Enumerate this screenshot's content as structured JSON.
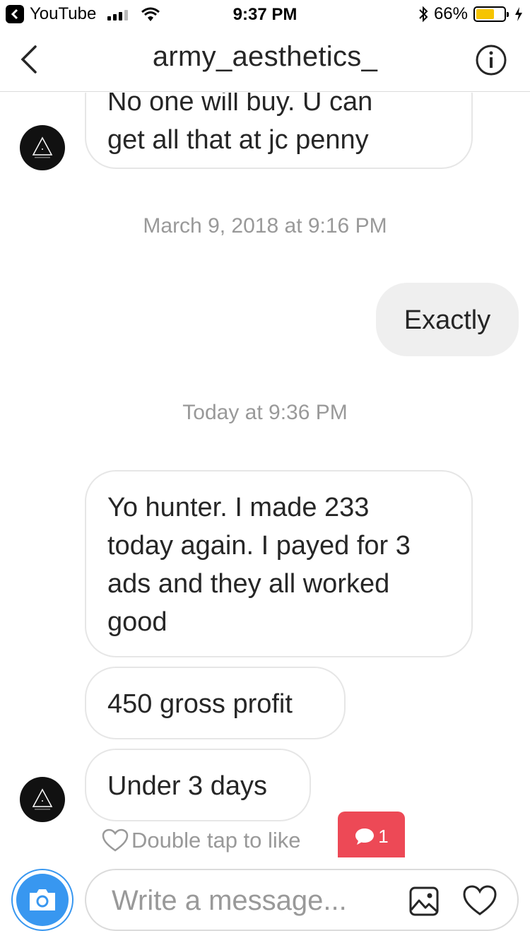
{
  "status_bar": {
    "back_app_label": "YouTube",
    "time": "9:37 PM",
    "battery_percent": "66%",
    "battery_level": 0.66
  },
  "header": {
    "title": "army_aesthetics_"
  },
  "messages": {
    "top_bubble": {
      "line1": "No one will buy. U can",
      "line2": "get all that at jc penny"
    },
    "timestamp1": "March 9, 2018 at 9:16 PM",
    "my_bubble": "Exactly",
    "timestamp2": "Today at 9:36 PM",
    "bubble_long": {
      "line1": "Yo hunter. I made 233",
      "line2": "today again. I payed for 3",
      "line3": "ads and they all worked",
      "line4": "good"
    },
    "bubble_profit": "450 gross profit",
    "bubble_days": "Under 3 days",
    "like_hint": "Double tap to like",
    "new_messages_count": "1"
  },
  "composer": {
    "placeholder": "Write a message..."
  },
  "colors": {
    "accent_blue": "#3897f0",
    "notification_red": "#ed4956",
    "battery_yellow": "#f6c400"
  }
}
